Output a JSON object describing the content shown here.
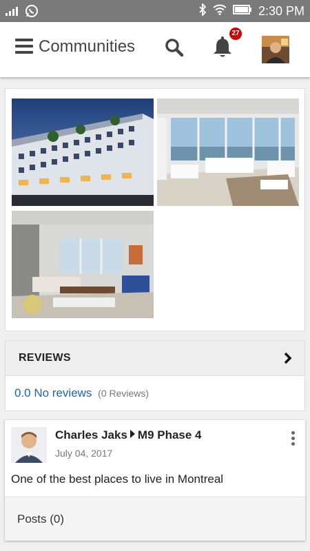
{
  "status_bar": {
    "time": "2:30 PM"
  },
  "app_bar": {
    "title": "Communities",
    "notification_count": "27"
  },
  "photos": [
    {
      "alt": "building-exterior"
    },
    {
      "alt": "living-room-view"
    },
    {
      "alt": "living-room-interior"
    }
  ],
  "reviews": {
    "header": "REVIEWS",
    "score_text": "0.0 No reviews",
    "count_text": "(0 Reviews)"
  },
  "post": {
    "author": "Charles Jaks",
    "community": "M9 Phase 4",
    "date": "July 04, 2017",
    "text": "One of the best places to live in Montreal",
    "posts_label": "Posts (0)"
  },
  "colors": {
    "link": "#1565c0",
    "badge": "#d50000",
    "status_bar": "#7a7a7a"
  }
}
